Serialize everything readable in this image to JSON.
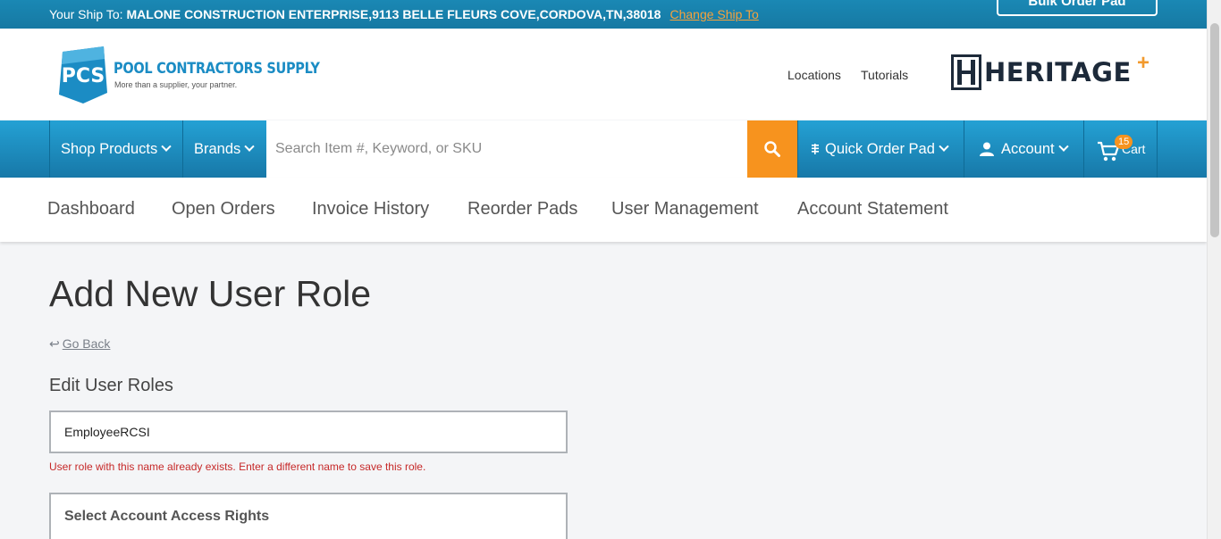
{
  "shipbar": {
    "label": "Your Ship To:",
    "address": "MALONE CONSTRUCTION ENTERPRISE,9113 BELLE FLEURS COVE,CORDOVA,TN,38018",
    "change_label": "Change Ship To",
    "bulk_label": "Bulk Order Pad"
  },
  "logo": {
    "abbrev": "PCS",
    "name": "POOL CONTRACTORS SUPPLY",
    "tagline": "More than a supplier, your partner.",
    "brand_color": "#1b8cc4"
  },
  "header": {
    "locations": "Locations",
    "tutorials": "Tutorials",
    "heritage": "HERITAGE",
    "heritage_plus": "+"
  },
  "nav": {
    "shop_products": "Shop Products",
    "brands": "Brands",
    "search_placeholder": "Search Item #, Keyword, or SKU",
    "quick_order": "Quick Order Pad",
    "account": "Account",
    "cart": "Cart",
    "cart_count": "15",
    "accent_color": "#f7931e"
  },
  "subnav": {
    "items": [
      "Dashboard",
      "Open Orders",
      "Invoice History",
      "Reorder Pads",
      "User Management",
      "Account Statement"
    ]
  },
  "main": {
    "title": "Add New User Role",
    "go_back": "Go Back",
    "section_title": "Edit User Roles",
    "role_value": "EmployeeRCSI",
    "error": "User role with this name already exists. Enter a different name to save this role.",
    "access_title": "Select Account Access Rights"
  }
}
